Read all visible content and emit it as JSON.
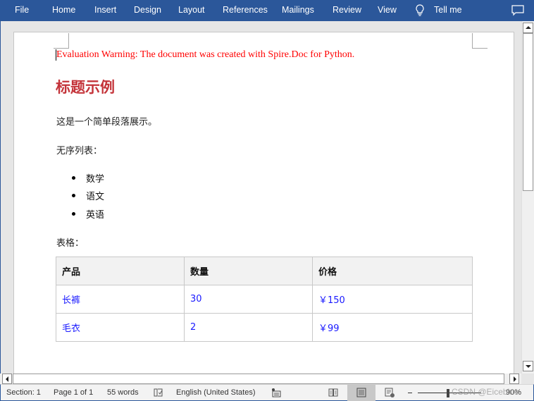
{
  "ribbon": {
    "tabs": [
      "File",
      "Home",
      "Insert",
      "Design",
      "Layout",
      "References",
      "Mailings",
      "Review",
      "View"
    ],
    "tell_me": "Tell me",
    "icons": {
      "tell_me": "lightbulb-icon",
      "comments": "comment-icon"
    },
    "background": "#2b579a"
  },
  "document": {
    "warning": "Evaluation Warning: The document was created with Spire.Doc for Python.",
    "heading": "标题示例",
    "paragraph": "这是一个简单段落展示。",
    "list_label": "无序列表：",
    "list_items": [
      "数学",
      "语文",
      "英语"
    ],
    "table_label": "表格：",
    "table": {
      "headers": [
        "产品",
        "数量",
        "价格"
      ],
      "rows": [
        [
          "长裤",
          "30",
          "￥150"
        ],
        [
          "毛衣",
          "2",
          "￥99"
        ]
      ]
    },
    "colors": {
      "warning": "#ff0000",
      "heading": "#c4343a",
      "table_cell": "#1a1aff"
    }
  },
  "statusbar": {
    "section": "Section: 1",
    "page": "Page 1 of 1",
    "words": "55 words",
    "language": "English (United States)",
    "zoom": "90%",
    "watermark": "CSDN @Eiceblue"
  }
}
